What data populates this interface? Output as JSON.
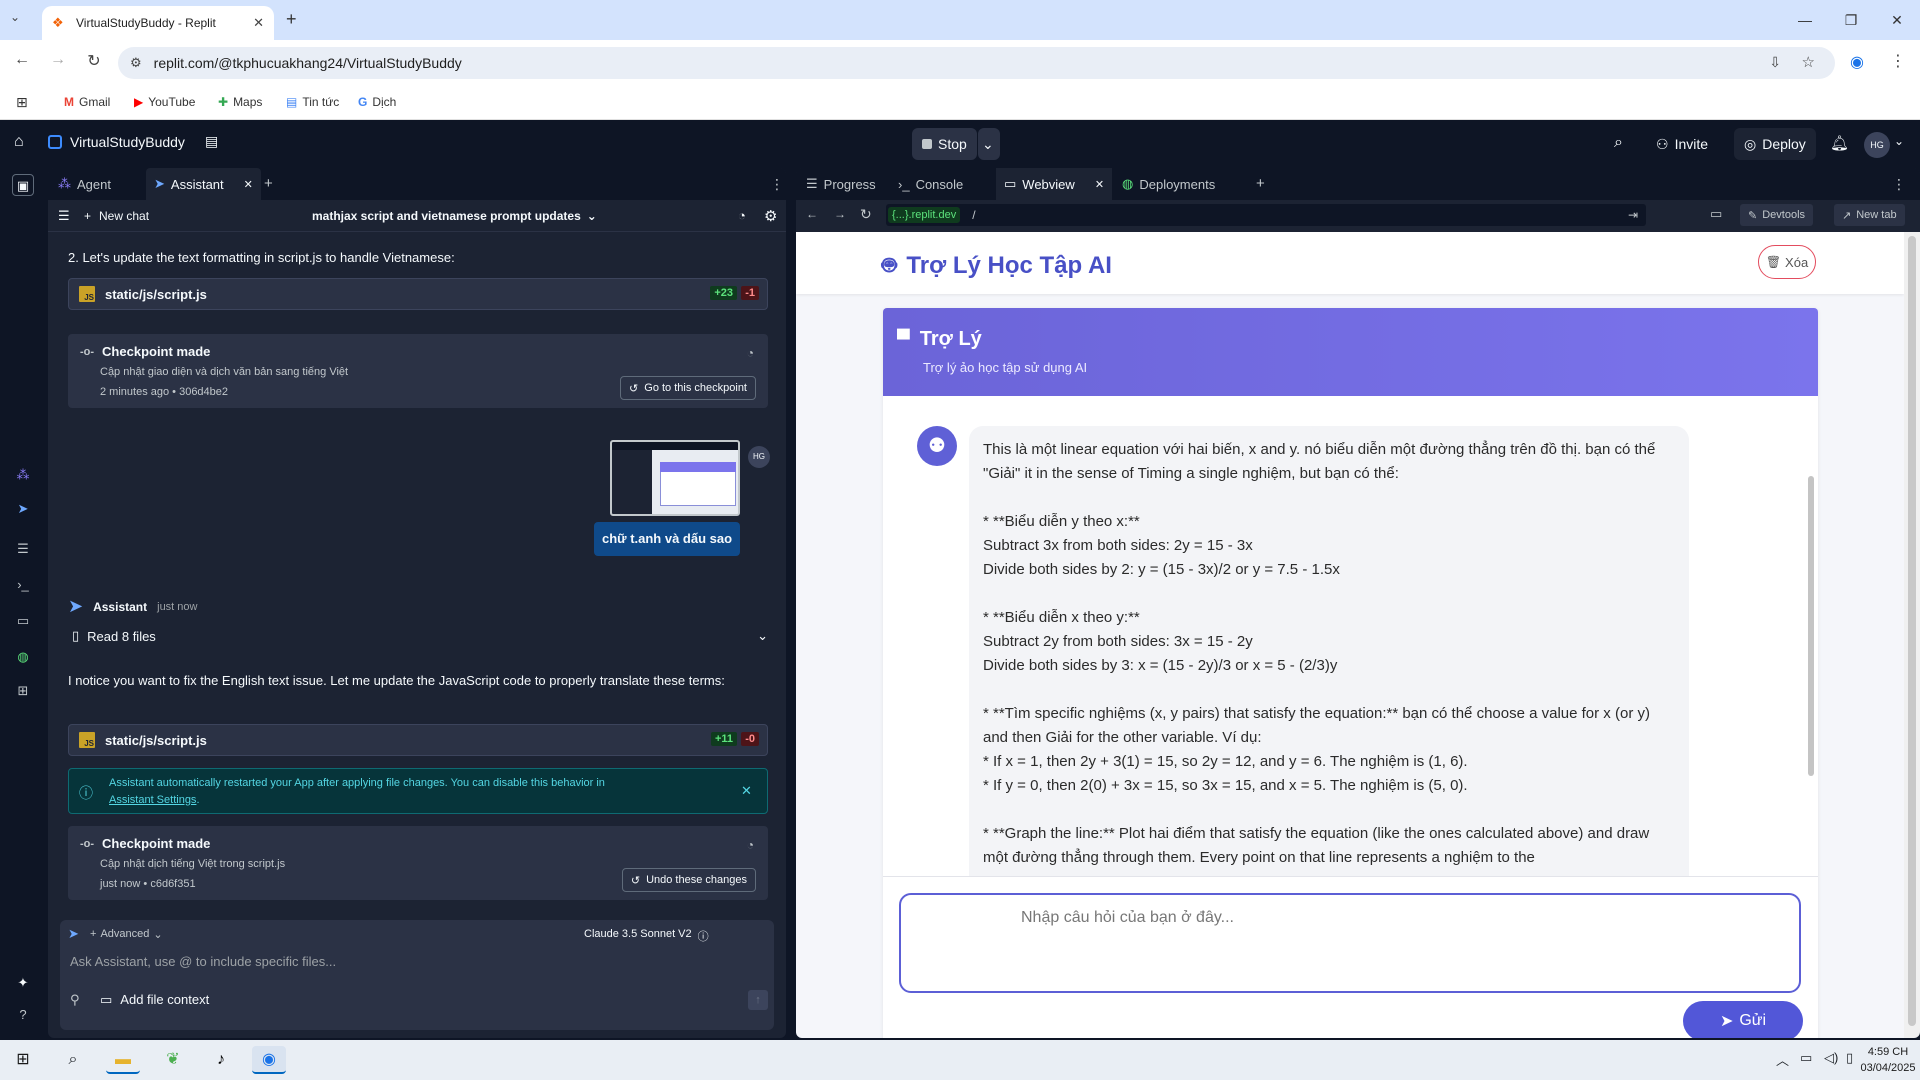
{
  "browser": {
    "tab_title": "VirtualStudyBuddy - Replit",
    "new_tab": "+",
    "url": "replit.com/@tkphucuakhang24/VirtualStudyBuddy",
    "bookmarks": [
      "Gmail",
      "YouTube",
      "Maps",
      "Tin tức",
      "Dịch"
    ]
  },
  "replit": {
    "project_name": "VirtualStudyBuddy",
    "stop_label": "Stop",
    "invite_label": "Invite",
    "deploy_label": "Deploy",
    "avatar_initials": "HG"
  },
  "left_tabs": [
    "Agent",
    "Assistant"
  ],
  "chat": {
    "new_chat": "New chat",
    "thread_title": "mathjax script and vietnamese prompt updates",
    "step2_text": "2. Let's update the text formatting in script.js to handle Vietnamese:",
    "file1": {
      "name": "static/js/script.js",
      "add": "+23",
      "del": "-1"
    },
    "checkpoint1": {
      "title": "Checkpoint made",
      "desc": "Cập nhật giao diện và dịch văn bản sang tiếng Việt",
      "time": "2 minutes ago",
      "hash": "• 306d4be2",
      "action": "Go to this checkpoint"
    },
    "user_avatar": "HG",
    "user_message": "chữ t.anh và dấu sao",
    "assistant_name": "Assistant",
    "assistant_time": "just now",
    "read_files": "Read 8 files",
    "assistant_text": "I notice you want to fix the English text issue. Let me update the JavaScript code to properly translate these terms:",
    "file2": {
      "name": "static/js/script.js",
      "add": "+11",
      "del": "-0"
    },
    "notice_text": "Assistant automatically restarted your App after applying file changes. You can disable this behavior in",
    "notice_link": "Assistant Settings",
    "notice_period": ".",
    "checkpoint2": {
      "title": "Checkpoint made",
      "desc": "Cập nhật dịch tiếng Việt trong script.js",
      "time": "just now",
      "hash": "• c6d6f351",
      "action": "Undo these changes"
    },
    "advanced": "Advanced",
    "model": "Claude 3.5 Sonnet V2",
    "input_placeholder": "Ask Assistant, use @ to include specific files...",
    "add_file_context": "Add file context"
  },
  "right_tabs": [
    "Progress",
    "Console",
    "Webview",
    "Deployments"
  ],
  "webview": {
    "domain_badge": "{...}.replit.dev",
    "path": "/",
    "devtools": "Devtools",
    "new_tab": "New tab"
  },
  "app": {
    "title": "Trợ Lý Học Tập AI",
    "clear_label": "Xóa",
    "card_title": "Trợ Lý",
    "card_subtitle": "Trợ lý ảo học tập sử dụng AI",
    "bot_message": [
      "This là một linear equation với hai biến, x and y. nó biểu diễn một đường thẳng trên đồ thị. bạn có thể \"Giải\" it in the sense of Timing a single nghiệm, but bạn có thể:",
      "",
      "* **Biểu diễn y theo x:**",
      "Subtract 3x from both sides: 2y = 15 - 3x",
      "Divide both sides by 2: y = (15 - 3x)/2 or y = 7.5 - 1.5x",
      "",
      "* **Biểu diễn x theo y:**",
      "Subtract 2y from both sides: 3x = 15 - 2y",
      "Divide both sides by 3: x = (15 - 2y)/3 or x = 5 - (2/3)y",
      "",
      "* **Tìm specific nghiệms (x, y pairs) that satisfy the equation:** bạn có thể choose a value for x (or y) and then Giải for the other variable. Ví dụ:",
      "* If x = 1, then 2y + 3(1) = 15, so 2y = 12, and y = 6. The nghiệm is (1, 6).",
      "* If y = 0, then 2(0) + 3x = 15, so 3x = 15, and x = 5. The nghiệm is (5, 0).",
      "",
      "* **Graph the line:** Plot hai điểm that satisfy the equation (like the ones calculated above) and draw một đường thẳng through them. Every point on that line represents a nghiệm to the"
    ],
    "input_placeholder": "Nhập câu hỏi của bạn ở đây...",
    "send_label": "Gửi"
  },
  "taskbar": {
    "time": "4:59 CH",
    "date": "03/04/2025"
  }
}
